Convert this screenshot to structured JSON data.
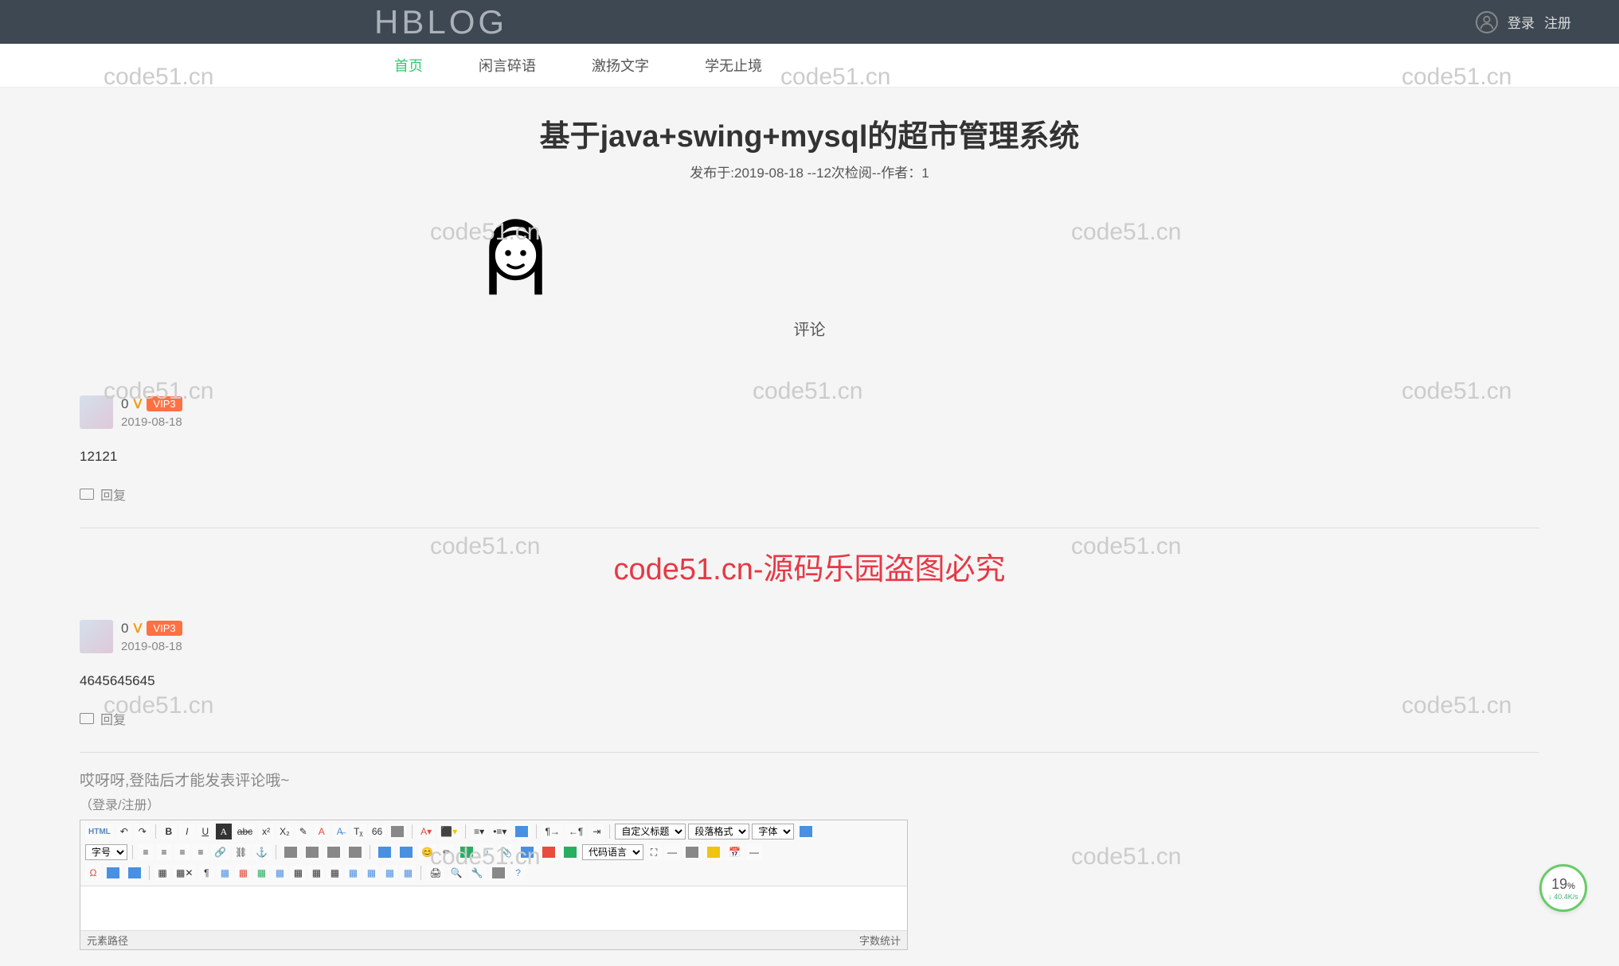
{
  "header": {
    "logo": "HBLOG",
    "login": "登录",
    "register": "注册"
  },
  "nav": {
    "items": [
      {
        "label": "首页",
        "active": true
      },
      {
        "label": "闲言碎语",
        "active": false
      },
      {
        "label": "激扬文字",
        "active": false
      },
      {
        "label": "学无止境",
        "active": false
      }
    ]
  },
  "article": {
    "title": "基于java+swing+mysql的超市管理系统",
    "meta": "发布于:2019-08-18 --12次检阅--作者：1"
  },
  "comments_header": "评论",
  "comments": [
    {
      "user": "0",
      "vip_level": "VIP3",
      "date": "2019-08-18",
      "body": "12121",
      "reply_label": "回复"
    },
    {
      "user": "0",
      "vip_level": "VIP3",
      "date": "2019-08-18",
      "body": "4645645645",
      "reply_label": "回复"
    }
  ],
  "watermark_center": "code51.cn-源码乐园盗图必究",
  "watermark_text": "code51.cn",
  "editor": {
    "login_prompt": "哎呀呀,登陆后才能发表评论哦~",
    "login_register": "（登录/注册）",
    "footer_left": "元素路径",
    "footer_right": "字数统计",
    "selects": {
      "custom_title": "自定义标题",
      "paragraph": "段落格式",
      "font": "字体",
      "font_size": "字号",
      "code_lang": "代码语言"
    },
    "toolbar_labels": {
      "html": "HTML",
      "bold": "B",
      "italic": "I",
      "underline": "U",
      "font_a": "A",
      "strikethrough": "abc",
      "superscript": "x²",
      "subscript": "X₂",
      "quote": "66"
    }
  },
  "speed_widget": {
    "percent": "19",
    "percent_unit": "%",
    "rate": "↓ 40.4K/s"
  }
}
